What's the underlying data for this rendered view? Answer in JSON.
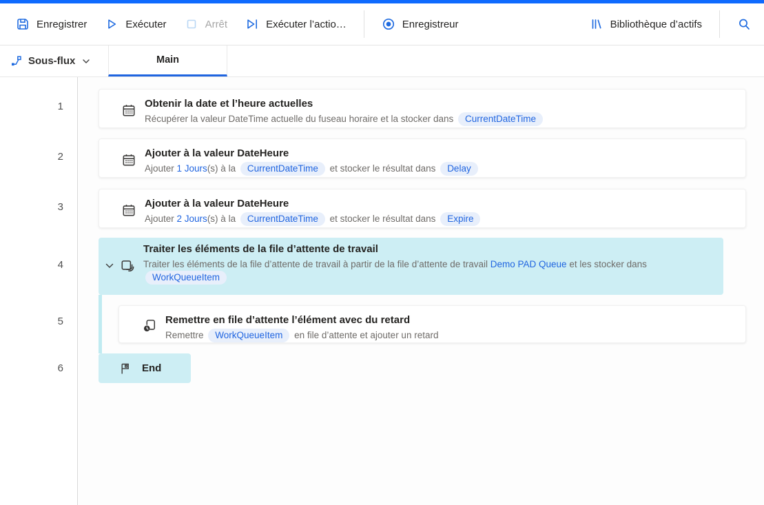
{
  "colors": {
    "accent_blue": "#2065e0",
    "icon_blue": "#1f6be0",
    "top_strip": "#0f6afe",
    "selection_teal": "#cdeef4",
    "pill_bg": "#e8effb",
    "disabled_icon": "#b9d7f5"
  },
  "toolbar": {
    "save": "Enregistrer",
    "run": "Exécuter",
    "stop": "Arrêt",
    "run_action": "Exécuter l’actio…",
    "recorder": "Enregistreur",
    "asset_library": "Bibliothèque d’actifs"
  },
  "subflow_bar": {
    "selector": "Sous-flux",
    "active_tab": "Main"
  },
  "flow": {
    "rows": [
      {
        "num": "1",
        "icon": "calendar-icon",
        "title": "Obtenir la date et l’heure actuelles",
        "desc": [
          {
            "t": "text",
            "v": "Récupérer la valeur DateTime actuelle du fuseau horaire et la stocker dans "
          },
          {
            "t": "pill",
            "v": "CurrentDateTime"
          }
        ]
      },
      {
        "num": "2",
        "icon": "calendar-icon",
        "title": "Ajouter à la valeur DateHeure",
        "desc": [
          {
            "t": "text",
            "v": "Ajouter "
          },
          {
            "t": "link",
            "v": "1 Jours"
          },
          {
            "t": "text",
            "v": "(s) à la "
          },
          {
            "t": "pill",
            "v": "CurrentDateTime"
          },
          {
            "t": "text",
            "v": " et stocker le résultat dans "
          },
          {
            "t": "pill",
            "v": "Delay"
          }
        ]
      },
      {
        "num": "3",
        "icon": "calendar-icon",
        "title": "Ajouter à la valeur DateHeure",
        "desc": [
          {
            "t": "text",
            "v": "Ajouter "
          },
          {
            "t": "link",
            "v": "2 Jours"
          },
          {
            "t": "text",
            "v": "(s) à la "
          },
          {
            "t": "pill",
            "v": "CurrentDateTime"
          },
          {
            "t": "text",
            "v": " et stocker le résultat dans "
          },
          {
            "t": "pill",
            "v": "Expire"
          }
        ]
      },
      {
        "num": "4",
        "icon": "layers-icon",
        "selected": true,
        "chevron": true,
        "title": "Traiter les éléments de la file d’attente de travail",
        "desc": [
          {
            "t": "text",
            "v": "Traiter les éléments de la file d’attente de travail à partir de la file d’attente de travail "
          },
          {
            "t": "link",
            "v": "Demo PAD Queue"
          },
          {
            "t": "text",
            "v": " et les stocker dans "
          },
          {
            "t": "pill",
            "v": "WorkQueueItem"
          }
        ]
      },
      {
        "num": "5",
        "icon": "requeue-clock-icon",
        "indent": true,
        "title": "Remettre en file d’attente l’élément avec du retard",
        "desc": [
          {
            "t": "text",
            "v": "Remettre "
          },
          {
            "t": "pill",
            "v": "WorkQueueItem"
          },
          {
            "t": "text",
            "v": " en file d’attente et ajouter un retard"
          }
        ]
      },
      {
        "num": "6",
        "icon": "flag-icon",
        "end": true,
        "title": "End",
        "desc": []
      }
    ]
  }
}
